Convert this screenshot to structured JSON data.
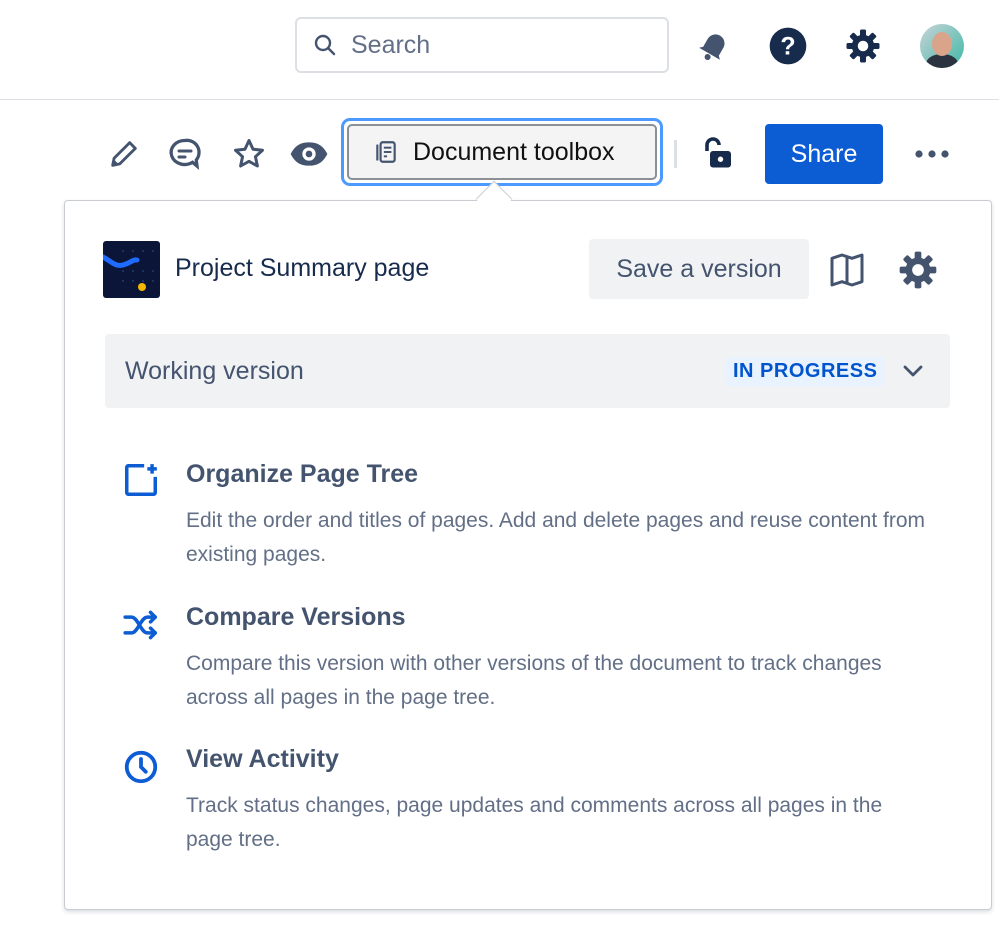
{
  "topbar": {
    "search_placeholder": "Search"
  },
  "toolbar": {
    "document_toolbox_label": "Document toolbox",
    "share_label": "Share"
  },
  "panel": {
    "page_title": "Project Summary page",
    "save_version_label": "Save a version",
    "version": {
      "label": "Working version",
      "status": "IN PROGRESS"
    },
    "items": [
      {
        "title": "Organize Page Tree",
        "description": "Edit the order and titles of pages. Add and delete pages and reuse content from existing pages."
      },
      {
        "title": "Compare Versions",
        "description": "Compare this version with other versions of the document to track changes across all pages in the page tree."
      },
      {
        "title": "View Activity",
        "description": "Track status changes, page updates and comments across all pages in the page tree."
      }
    ]
  },
  "colors": {
    "accent": "#0c5cd4",
    "icon": "#44546f",
    "badge_bg": "#e9f2ff",
    "badge_text": "#0055cc"
  }
}
